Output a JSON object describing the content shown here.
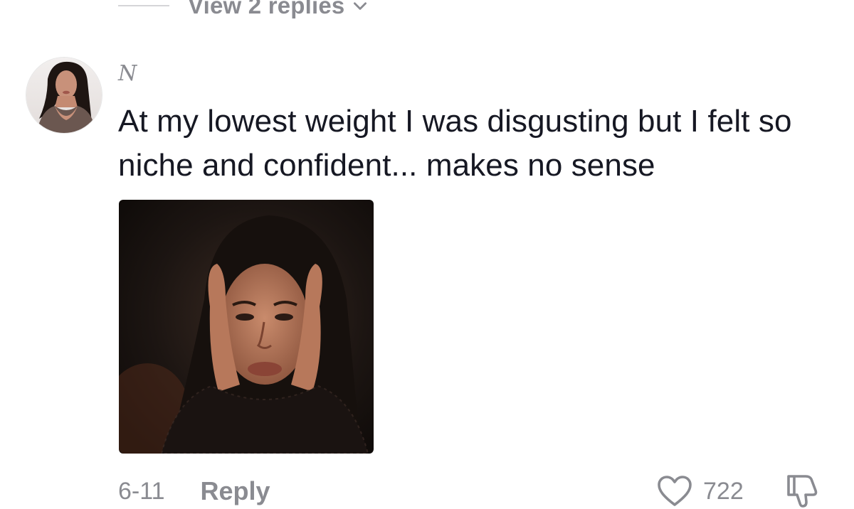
{
  "previous_thread": {
    "view_replies_label": "View 2 replies",
    "chevron_icon": "chevron-down-icon"
  },
  "comment": {
    "avatar_icon": "user-avatar",
    "username": "N",
    "text": "At my lowest weight I was disgusting but I felt so niche and confident... makes no sense",
    "attached_image_icon": "reaction-photo",
    "date": "6-11",
    "reply_label": "Reply",
    "like_icon": "heart-icon",
    "like_count": "722",
    "dislike_icon": "thumbs-down-icon"
  },
  "colors": {
    "text_primary": "#161823",
    "text_secondary": "#8a8b91",
    "background": "#ffffff"
  }
}
